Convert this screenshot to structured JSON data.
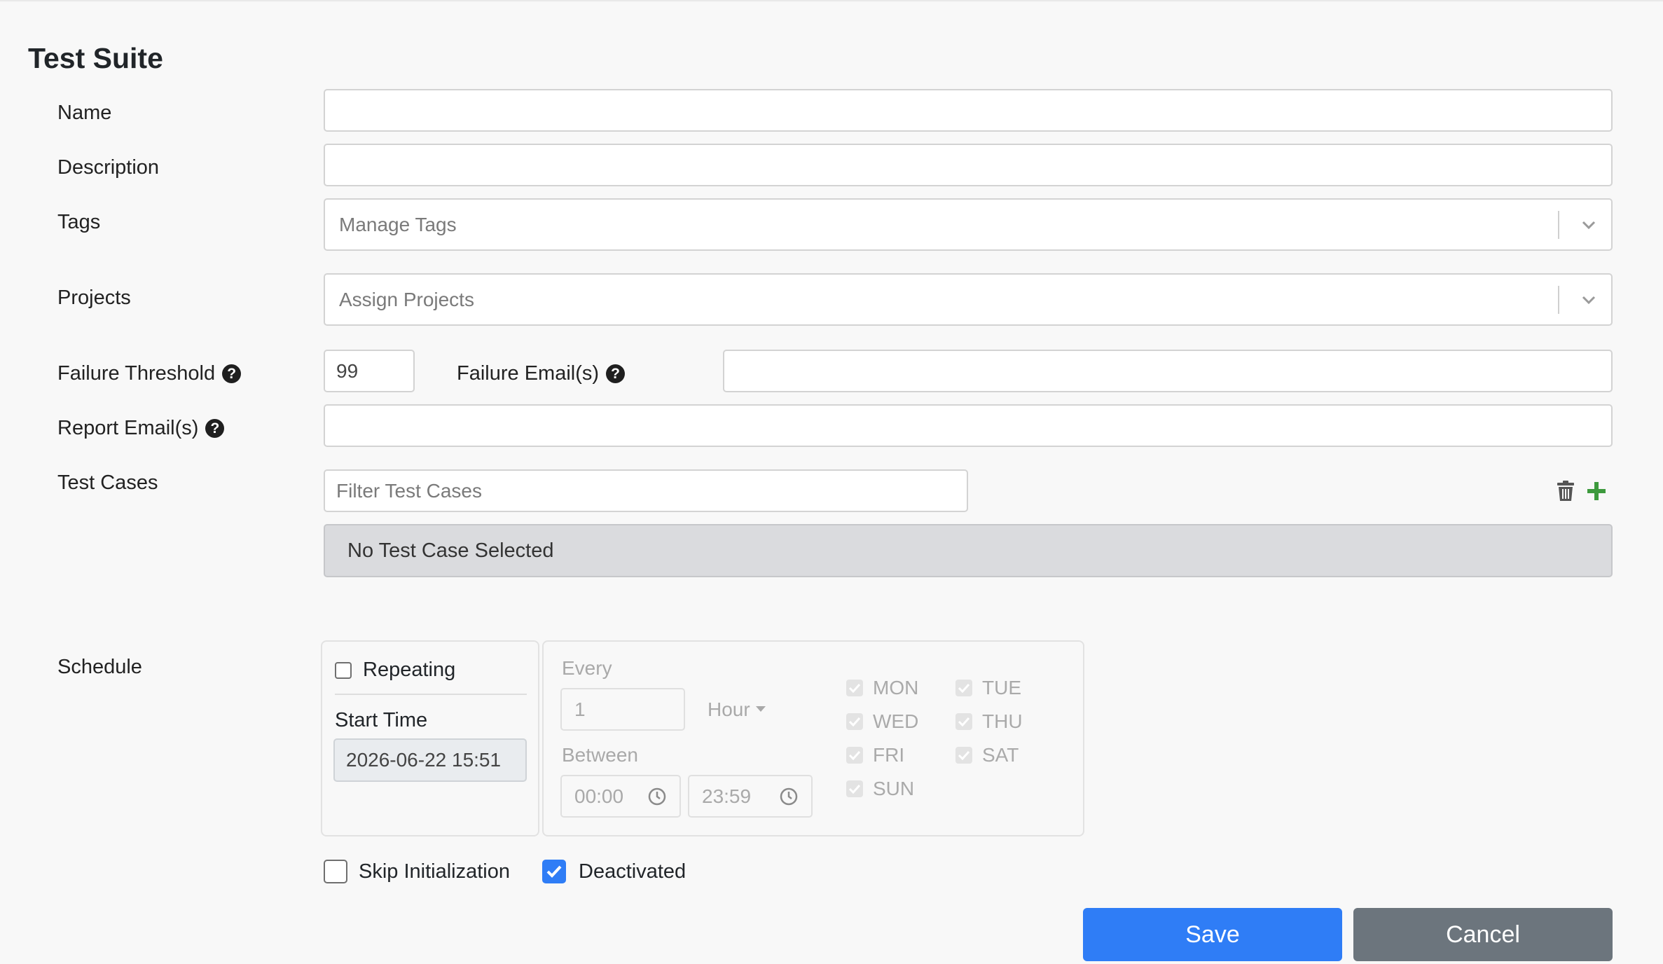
{
  "page": {
    "title": "Test Suite"
  },
  "form": {
    "name": {
      "label": "Name",
      "value": ""
    },
    "description": {
      "label": "Description",
      "value": ""
    },
    "tags": {
      "label": "Tags",
      "placeholder": "Manage Tags",
      "icon": "chevron-down-icon"
    },
    "projects": {
      "label": "Projects",
      "placeholder": "Assign Projects",
      "icon": "chevron-down-icon"
    },
    "failure_threshold": {
      "label": "Failure Threshold",
      "value": "99",
      "help_icon": "question-circle-icon"
    },
    "failure_emails": {
      "label": "Failure Email(s)",
      "value": "",
      "help_icon": "question-circle-icon"
    },
    "report_emails": {
      "label": "Report Email(s)",
      "value": "",
      "help_icon": "question-circle-icon"
    },
    "test_cases": {
      "label": "Test Cases",
      "filter_placeholder": "Filter Test Cases",
      "empty_text": "No Test Case Selected",
      "delete_icon": "trash-icon",
      "add_icon": "plus-icon"
    },
    "schedule": {
      "label": "Schedule",
      "repeating_label": "Repeating",
      "repeating_checked": false,
      "start_time_label": "Start Time",
      "start_time_value": "2026-06-22 15:51",
      "every_label": "Every",
      "every_value": "1",
      "unit": "Hour",
      "between_label": "Between",
      "from_time": "00:00",
      "to_time": "23:59",
      "days": [
        {
          "label": "MON",
          "checked": true
        },
        {
          "label": "TUE",
          "checked": true
        },
        {
          "label": "WED",
          "checked": true
        },
        {
          "label": "THU",
          "checked": true
        },
        {
          "label": "FRI",
          "checked": true
        },
        {
          "label": "SAT",
          "checked": true
        },
        {
          "label": "SUN",
          "checked": true
        }
      ]
    },
    "skip_initialization": {
      "label": "Skip Initialization",
      "checked": false
    },
    "deactivated": {
      "label": "Deactivated",
      "checked": true
    }
  },
  "actions": {
    "save": "Save",
    "cancel": "Cancel"
  },
  "colors": {
    "primary": "#2f7df6",
    "secondary": "#6c757d",
    "add": "#3d9a3d"
  }
}
